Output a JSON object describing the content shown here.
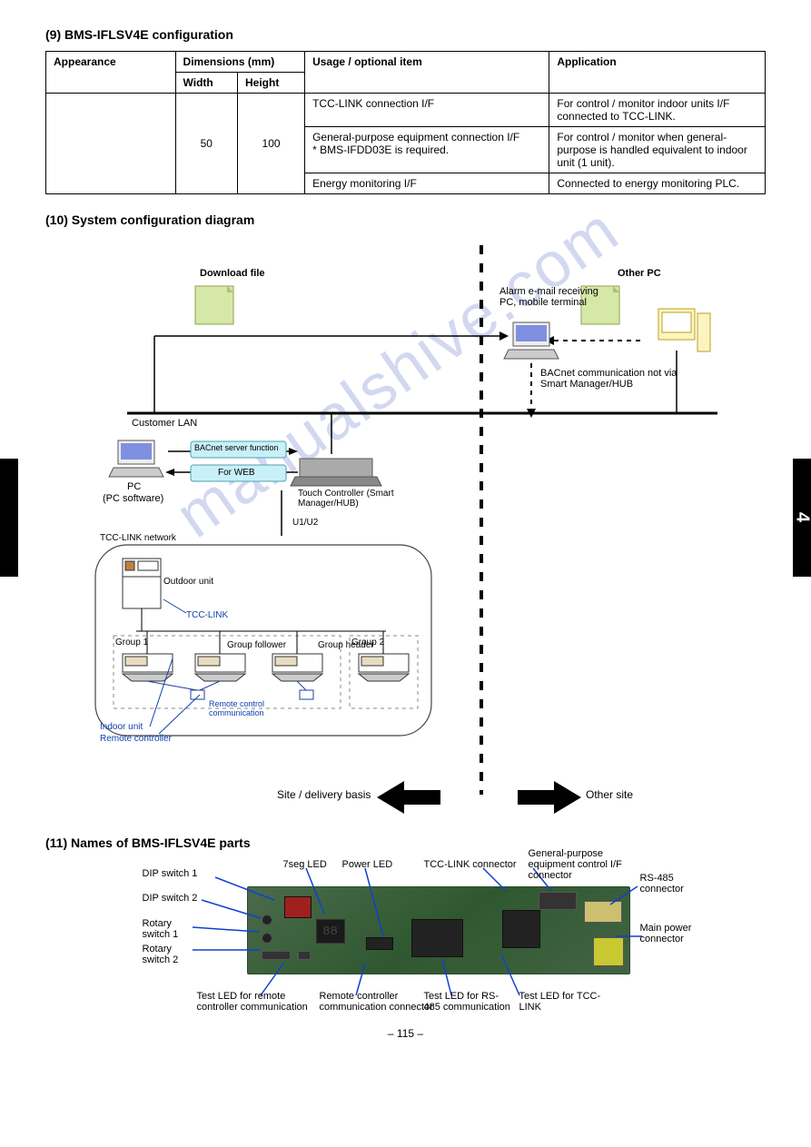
{
  "sidebar_number": "4",
  "section1_title": "(9) BMS-IFLSV4E configuration",
  "table": {
    "headers": [
      "Appearance",
      "Dimensions (mm)",
      "Usage / optional item",
      "Application"
    ],
    "subheaders": [
      "Width",
      "Height"
    ],
    "rows": [
      {
        "appearance": "",
        "width": "",
        "height": "",
        "usage": "TCC-LINK connection I/F",
        "application": "For control / monitor indoor units I/F connected to TCC-LINK."
      },
      {
        "appearance": "",
        "width": "50",
        "height": "100",
        "usage": "General-purpose equipment connection I/F\n* BMS-IFDD03E is required.",
        "application": "For control / monitor when general-purpose is handled equivalent to indoor unit (1 unit)."
      },
      {
        "appearance": "",
        "width": "",
        "height": "",
        "usage": "Energy monitoring I/F",
        "application": "Connected to energy monitoring PLC."
      }
    ]
  },
  "section2_title": "(10) System configuration diagram",
  "diagram": {
    "top_labels": {
      "customer_lan": "Customer LAN",
      "download_file": "Download file",
      "other_pc": "Other PC",
      "alarm_email": "Alarm e-mail receiving PC, mobile terminal",
      "bacnet": "BACnet communication not via Smart Manager/HUB",
      "pc": "PC",
      "pc_software": "(PC software)",
      "bacnet_server": "BACnet server function",
      "web": "For WEB",
      "touch": "Touch Controller (Smart Manager/HUB)",
      "uu": "U1/U2",
      "tcc_network": "TCC-LINK network",
      "tcc_link": "TCC-LINK",
      "outdoor": "Outdoor unit",
      "group1": "Group 1",
      "group2": "Group 2",
      "follower": "Group follower",
      "header": "Group header",
      "ri": "Remote control communication",
      "indoor": "Indoor unit",
      "remote": "Remote controller"
    },
    "side_labels": {
      "other_site": "Other site",
      "site_basis": "Site / delivery basis"
    }
  },
  "section3_title": "(11) Names of BMS-IFLSV4E parts",
  "board": {
    "left": {
      "d1": "DIP switch 1",
      "d2": "DIP switch 2",
      "r1": "Rotary switch 1",
      "r2": "Rotary switch 2"
    },
    "top": {
      "seg": "7seg LED",
      "power": "Power LED",
      "tcc_con": "TCC-LINK connector",
      "gp_con": "General-purpose equipment control I/F connector"
    },
    "right": {
      "rs485": "RS-485 connector",
      "main_power": "Main power connector"
    },
    "bottom": {
      "rc_led": "Test LED for remote controller communication",
      "rc_con": "Remote controller communication connector",
      "rs_led": "Test LED for RS-485 communication",
      "tcc_led": "Test LED for TCC-LINK"
    }
  },
  "page_number": "– 115 –",
  "watermark": "manualshive.com"
}
